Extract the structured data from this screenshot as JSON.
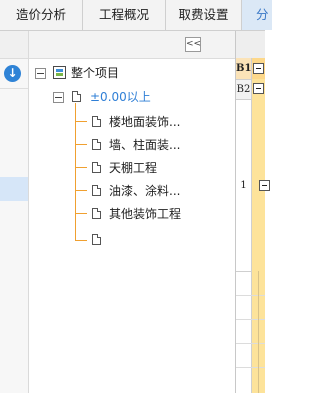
{
  "tabs": [
    {
      "label": "造价分析"
    },
    {
      "label": "工程概况"
    },
    {
      "label": "取费设置"
    },
    {
      "label": "分"
    }
  ],
  "left_strip": {
    "download_icon": "download-circle-icon"
  },
  "tree": {
    "collapse_label": "<<",
    "root": {
      "label": "整个项目",
      "icon": "project-icon"
    },
    "level1": {
      "label": "±0.00以上",
      "icon": "file-icon"
    },
    "children": [
      {
        "label": "楼地面装饰..."
      },
      {
        "label": "墙、柱面装..."
      },
      {
        "label": "天棚工程"
      },
      {
        "label": "油漆、涂料..."
      },
      {
        "label": "其他装饰工程"
      },
      {
        "label": ""
      }
    ]
  },
  "grid": {
    "rows": [
      {
        "label": "B1"
      },
      {
        "label": "B2"
      },
      {
        "label": "1"
      }
    ]
  },
  "colors": {
    "accent": "#2f83d6",
    "link": "#2f7fd6",
    "tree_line": "#f0a030",
    "grid_highlight": "#fde39a",
    "active_tab_bg": "#dbe8f6"
  }
}
